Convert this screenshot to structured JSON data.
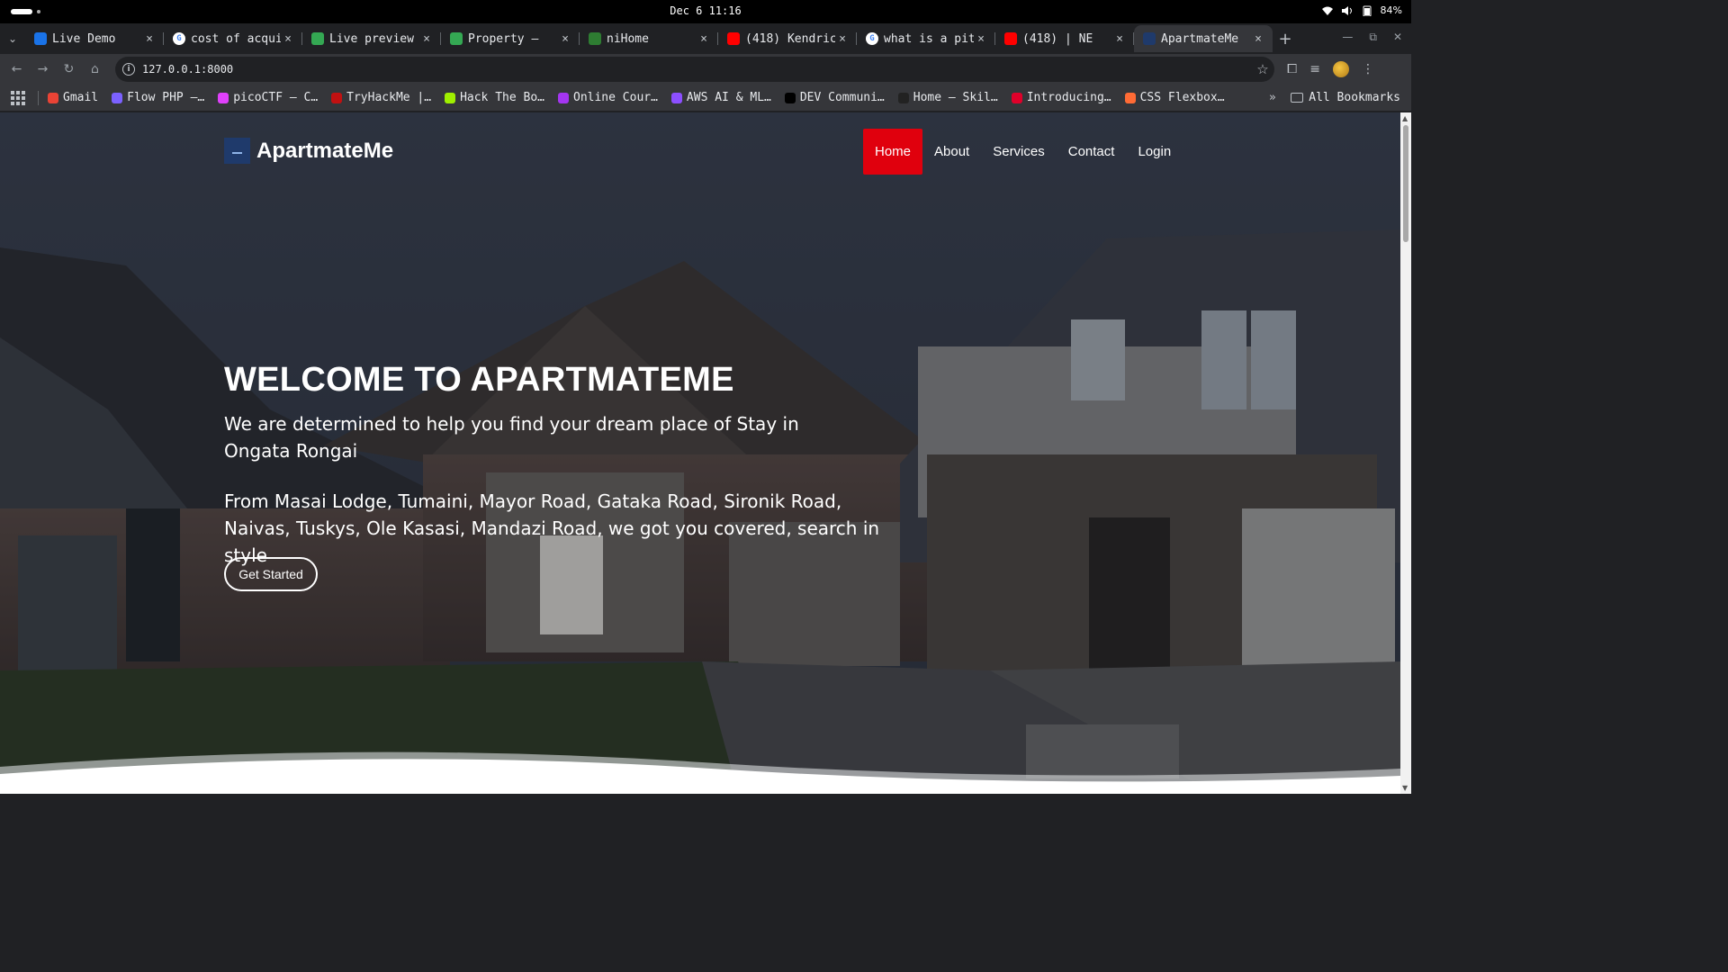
{
  "system": {
    "clock": "Dec 6 11:16",
    "battery": "84%"
  },
  "tabs": [
    {
      "title": "Live Demo",
      "favicon": "blue-square-icon",
      "color": "#1a73e8"
    },
    {
      "title": "cost of acqui",
      "favicon": "google-icon",
      "color": "#ffffff"
    },
    {
      "title": "Live preview",
      "favicon": "green-leaf-icon",
      "color": "#34a853"
    },
    {
      "title": "Property –",
      "favicon": "green-leaf-icon",
      "color": "#34a853"
    },
    {
      "title": "niHome",
      "favicon": "green-leaf-icon",
      "color": "#2e7d32"
    },
    {
      "title": "(418) Kendric",
      "favicon": "youtube-icon",
      "color": "#ff0000"
    },
    {
      "title": "what is a pit",
      "favicon": "google-icon",
      "color": "#ffffff"
    },
    {
      "title": "(418) | NE",
      "favicon": "youtube-icon",
      "color": "#ff0000"
    },
    {
      "title": "ApartmateMe",
      "favicon": "apartmate-icon",
      "color": "#1f3a6b",
      "active": true
    }
  ],
  "toolbar": {
    "url": "127.0.0.1:8000"
  },
  "bookmarks": [
    {
      "label": "Gmail",
      "icon": "gmail-icon",
      "color": "#ea4335"
    },
    {
      "label": "Flow PHP –…",
      "icon": "flow-icon",
      "color": "#7b61ff"
    },
    {
      "label": "picoCTF – C…",
      "icon": "picoctf-icon",
      "color": "#e040fb"
    },
    {
      "label": "TryHackMe |…",
      "icon": "tryhackme-icon",
      "color": "#c11111"
    },
    {
      "label": "Hack The Bo…",
      "icon": "htb-icon",
      "color": "#9fef00"
    },
    {
      "label": "Online Cour…",
      "icon": "course-icon",
      "color": "#a435f0"
    },
    {
      "label": "AWS AI & ML…",
      "icon": "aws-icon",
      "color": "#8c4fff"
    },
    {
      "label": "DEV Communi…",
      "icon": "dev-icon",
      "color": "#000000"
    },
    {
      "label": "Home – Skil…",
      "icon": "skill-icon",
      "color": "#222222"
    },
    {
      "label": "Introducing…",
      "icon": "ig-icon",
      "color": "#e0002a"
    },
    {
      "label": "CSS Flexbox…",
      "icon": "flexbox-icon",
      "color": "#ff6b35"
    }
  ],
  "bookmarks_more": "»",
  "all_bookmarks": "All Bookmarks",
  "site": {
    "logo_text": "ApartmateMe",
    "nav": [
      {
        "label": "Home",
        "active": true
      },
      {
        "label": "About"
      },
      {
        "label": "Services"
      },
      {
        "label": "Contact"
      },
      {
        "label": "Login"
      }
    ],
    "hero_title": "WELCOME TO APARTMATEME",
    "hero_sub": "We are determined to help you find your dream place of Stay in Ongata Rongai",
    "hero_desc": "From Masai Lodge, Tumaini, Mayor Road, Gataka Road, Sironik Road, Naivas, Tuskys, Ole Kasasi, Mandazi Road, we got you covered, search in style",
    "cta_label": "Get Started",
    "accent_color": "#e0000d"
  }
}
